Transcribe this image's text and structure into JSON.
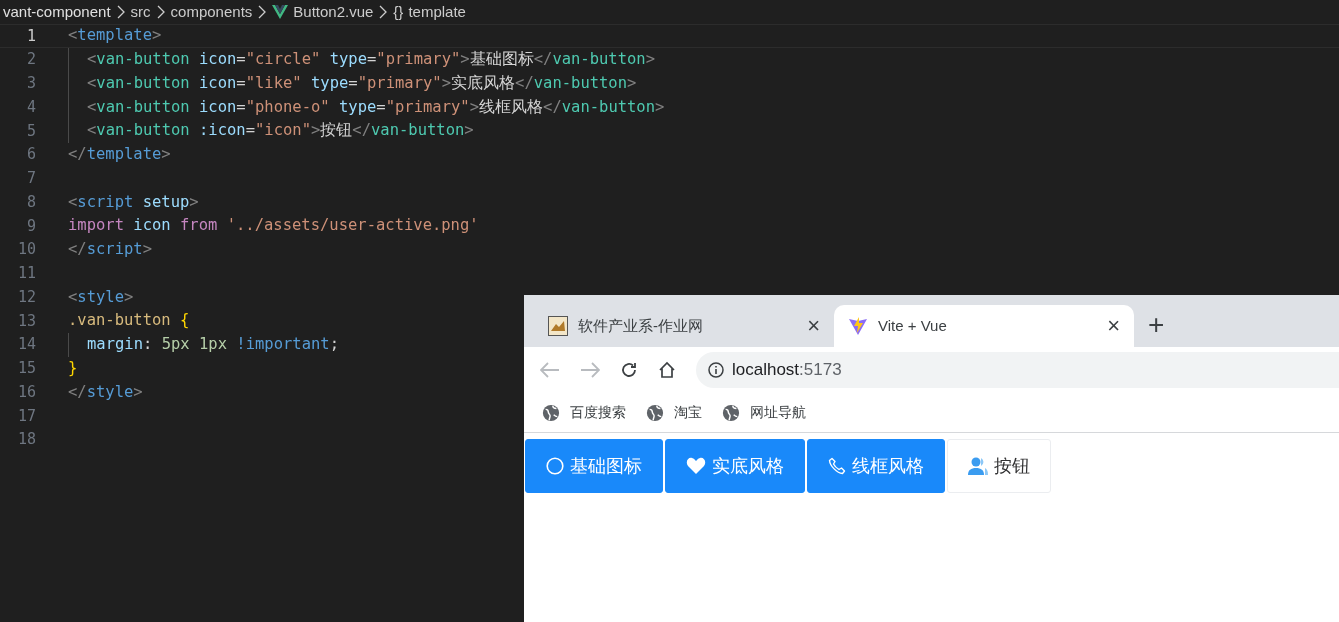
{
  "breadcrumb": {
    "items": [
      {
        "label": "vant-component",
        "kind": "folder"
      },
      {
        "label": "src",
        "kind": "folder"
      },
      {
        "label": "components",
        "kind": "folder"
      },
      {
        "label": "Button2.vue",
        "kind": "vue"
      },
      {
        "label": "template",
        "kind": "symbol",
        "glyph": "{}"
      }
    ]
  },
  "editor": {
    "lines": [
      {
        "number": "1",
        "current": true,
        "indented": false,
        "tokens": [
          {
            "kind": "punct",
            "text": "<"
          },
          {
            "kind": "tag",
            "text": "template"
          },
          {
            "kind": "punct",
            "text": ">"
          }
        ]
      },
      {
        "number": "2",
        "current": false,
        "indented": true,
        "tokens": [
          {
            "kind": "punct",
            "text": "<"
          },
          {
            "kind": "comp",
            "text": "van-button"
          },
          {
            "kind": "attr",
            "text": " icon"
          },
          {
            "kind": "plain",
            "text": "="
          },
          {
            "kind": "string",
            "text": "\"circle\""
          },
          {
            "kind": "attr",
            "text": " type"
          },
          {
            "kind": "plain",
            "text": "="
          },
          {
            "kind": "string",
            "text": "\"primary\""
          },
          {
            "kind": "punct",
            "text": ">"
          },
          {
            "kind": "plain",
            "text": "基础图标"
          },
          {
            "kind": "punct",
            "text": "</"
          },
          {
            "kind": "comp",
            "text": "van-button"
          },
          {
            "kind": "punct",
            "text": ">"
          }
        ]
      },
      {
        "number": "3",
        "current": false,
        "indented": true,
        "tokens": [
          {
            "kind": "punct",
            "text": "<"
          },
          {
            "kind": "comp",
            "text": "van-button"
          },
          {
            "kind": "attr",
            "text": " icon"
          },
          {
            "kind": "plain",
            "text": "="
          },
          {
            "kind": "string",
            "text": "\"like\""
          },
          {
            "kind": "attr",
            "text": " type"
          },
          {
            "kind": "plain",
            "text": "="
          },
          {
            "kind": "string",
            "text": "\"primary\""
          },
          {
            "kind": "punct",
            "text": ">"
          },
          {
            "kind": "plain",
            "text": "实底风格"
          },
          {
            "kind": "punct",
            "text": "</"
          },
          {
            "kind": "comp",
            "text": "van-button"
          },
          {
            "kind": "punct",
            "text": ">"
          }
        ]
      },
      {
        "number": "4",
        "current": false,
        "indented": true,
        "tokens": [
          {
            "kind": "punct",
            "text": "<"
          },
          {
            "kind": "comp",
            "text": "van-button"
          },
          {
            "kind": "attr",
            "text": " icon"
          },
          {
            "kind": "plain",
            "text": "="
          },
          {
            "kind": "string",
            "text": "\"phone-o\""
          },
          {
            "kind": "attr",
            "text": " type"
          },
          {
            "kind": "plain",
            "text": "="
          },
          {
            "kind": "string",
            "text": "\"primary\""
          },
          {
            "kind": "punct",
            "text": ">"
          },
          {
            "kind": "plain",
            "text": "线框风格"
          },
          {
            "kind": "punct",
            "text": "</"
          },
          {
            "kind": "comp",
            "text": "van-button"
          },
          {
            "kind": "punct",
            "text": ">"
          }
        ]
      },
      {
        "number": "5",
        "current": false,
        "indented": true,
        "tokens": [
          {
            "kind": "punct",
            "text": "<"
          },
          {
            "kind": "comp",
            "text": "van-button"
          },
          {
            "kind": "attr",
            "text": " :icon"
          },
          {
            "kind": "plain",
            "text": "="
          },
          {
            "kind": "string",
            "text": "\"icon\""
          },
          {
            "kind": "punct",
            "text": ">"
          },
          {
            "kind": "plain",
            "text": "按钮"
          },
          {
            "kind": "punct",
            "text": "</"
          },
          {
            "kind": "comp",
            "text": "van-button"
          },
          {
            "kind": "punct",
            "text": ">"
          }
        ]
      },
      {
        "number": "6",
        "current": false,
        "indented": false,
        "tokens": [
          {
            "kind": "punct",
            "text": "</"
          },
          {
            "kind": "tag",
            "text": "template"
          },
          {
            "kind": "punct",
            "text": ">"
          }
        ]
      },
      {
        "number": "7",
        "current": false
      },
      {
        "number": "8",
        "current": false,
        "indented": false,
        "tokens": [
          {
            "kind": "punct",
            "text": "<"
          },
          {
            "kind": "tag",
            "text": "script"
          },
          {
            "kind": "attr",
            "text": " setup"
          },
          {
            "kind": "punct",
            "text": ">"
          }
        ]
      },
      {
        "number": "9",
        "current": false,
        "indented": false,
        "tokens": [
          {
            "kind": "keyword",
            "text": "import"
          },
          {
            "kind": "attr",
            "text": " icon "
          },
          {
            "kind": "keyword",
            "text": "from"
          },
          {
            "kind": "string",
            "text": " '../assets/user-active.png'"
          }
        ]
      },
      {
        "number": "10",
        "current": false,
        "indented": false,
        "tokens": [
          {
            "kind": "punct",
            "text": "</"
          },
          {
            "kind": "tag",
            "text": "script"
          },
          {
            "kind": "punct",
            "text": ">"
          }
        ]
      },
      {
        "number": "11",
        "current": false
      },
      {
        "number": "12",
        "current": false,
        "indented": false,
        "tokens": [
          {
            "kind": "punct",
            "text": "<"
          },
          {
            "kind": "tag",
            "text": "style"
          },
          {
            "kind": "punct",
            "text": ">"
          }
        ]
      },
      {
        "number": "13",
        "current": false,
        "indented": false,
        "tokens": [
          {
            "kind": "selector",
            "text": ".van-button "
          },
          {
            "kind": "brace",
            "text": "{"
          }
        ]
      },
      {
        "number": "14",
        "current": false,
        "indented": true,
        "tokens": [
          {
            "kind": "attr",
            "text": "margin"
          },
          {
            "kind": "plain",
            "text": ": "
          },
          {
            "kind": "number",
            "text": "5px 1px"
          },
          {
            "kind": "tag",
            "text": " !important"
          },
          {
            "kind": "plain",
            "text": ";"
          }
        ]
      },
      {
        "number": "15",
        "current": false,
        "indented": false,
        "tokens": [
          {
            "kind": "brace",
            "text": "}"
          }
        ]
      },
      {
        "number": "16",
        "current": false,
        "indented": false,
        "tokens": [
          {
            "kind": "punct",
            "text": "</"
          },
          {
            "kind": "tag",
            "text": "style"
          },
          {
            "kind": "punct",
            "text": ">"
          }
        ]
      },
      {
        "number": "17",
        "current": false
      },
      {
        "number": "18",
        "current": false
      }
    ]
  },
  "browser": {
    "tabs": [
      {
        "title": "软件产业系-作业网",
        "close": "×",
        "selected": false
      },
      {
        "title": "Vite + Vue",
        "close": "×",
        "selected": true
      }
    ],
    "new_tab": "+",
    "nav": {
      "back_disabled": true,
      "forward_disabled": true
    },
    "address": {
      "host": "localhost",
      "port": ":5173"
    },
    "bookmarks": [
      {
        "label": "百度搜索"
      },
      {
        "label": "淘宝"
      },
      {
        "label": "网址导航"
      }
    ],
    "buttons": [
      {
        "label": "基础图标",
        "kind": "primary"
      },
      {
        "label": "实底风格",
        "kind": "primary"
      },
      {
        "label": "线框风格",
        "kind": "primary"
      },
      {
        "label": "按钮",
        "kind": "default"
      }
    ]
  }
}
